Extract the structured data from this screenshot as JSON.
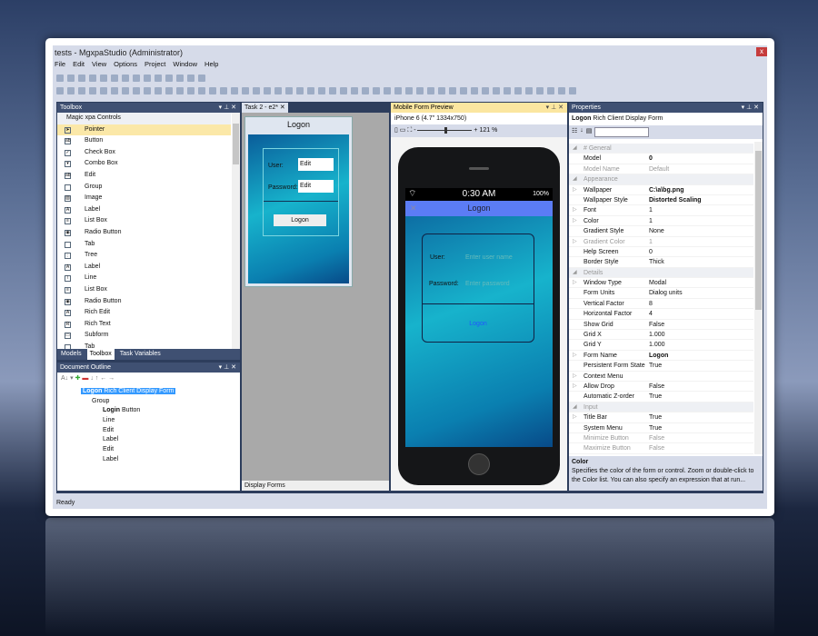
{
  "window": {
    "title": "tests - MgxpaStudio (Administrator)",
    "close": "x",
    "status": "Ready"
  },
  "menu": [
    "File",
    "Edit",
    "View",
    "Options",
    "Project",
    "Window",
    "Help"
  ],
  "toolbox": {
    "title": "Toolbox",
    "group": "Magic xpa Controls",
    "items": [
      {
        "label": "Pointer",
        "icon": "pointer-icon",
        "g": "➤"
      },
      {
        "label": "Button",
        "icon": "button-icon",
        "g": "ab"
      },
      {
        "label": "Check Box",
        "icon": "checkbox-icon",
        "g": "✓"
      },
      {
        "label": "Combo Box",
        "icon": "combo-box-icon",
        "g": "▾"
      },
      {
        "label": "Edit",
        "icon": "edit-icon",
        "g": "ab"
      },
      {
        "label": "Group",
        "icon": "group-icon",
        "g": ""
      },
      {
        "label": "Image",
        "icon": "image-icon",
        "g": "▨"
      },
      {
        "label": "Label",
        "icon": "label-icon",
        "g": "A"
      },
      {
        "label": "List Box",
        "icon": "list-box-icon",
        "g": "≡"
      },
      {
        "label": "Radio Button",
        "icon": "radio-button-icon",
        "g": "◉"
      },
      {
        "label": "Tab",
        "icon": "tab-icon",
        "g": ""
      },
      {
        "label": "Tree",
        "icon": "tree-icon",
        "g": "⋮"
      },
      {
        "label": "Label",
        "icon": "label-icon",
        "g": "A"
      },
      {
        "label": "Line",
        "icon": "line-icon",
        "g": "\\"
      },
      {
        "label": "List Box",
        "icon": "list-box-icon",
        "g": "≡"
      },
      {
        "label": "Radio Button",
        "icon": "radio-button-icon",
        "g": "◉"
      },
      {
        "label": "Rich Edit",
        "icon": "rich-edit-icon",
        "g": "A"
      },
      {
        "label": "Rich Text",
        "icon": "rich-text-icon",
        "g": "R"
      },
      {
        "label": "Subform",
        "icon": "subform-icon",
        "g": "▭"
      },
      {
        "label": "Tab",
        "icon": "tab-icon",
        "g": ""
      }
    ],
    "tabs": [
      "Models",
      "Toolbox",
      "Task Variables"
    ]
  },
  "outline": {
    "title": "Document Outline",
    "root_name": "Logon",
    "root_type": "Rich Client Display Form",
    "items": [
      {
        "name": "Group",
        "type": "",
        "depth": 1
      },
      {
        "name": "Login",
        "type": "Button",
        "depth": 2
      },
      {
        "name": "Line",
        "type": "",
        "depth": 2
      },
      {
        "name": "Edit",
        "type": "",
        "depth": 2
      },
      {
        "name": "Label",
        "type": "",
        "depth": 2
      },
      {
        "name": "Edit",
        "type": "",
        "depth": 2
      },
      {
        "name": "Label",
        "type": "",
        "depth": 2
      }
    ]
  },
  "task": {
    "tab": "Task  2 - e2*",
    "form_title": "Logon",
    "user_label": "User:",
    "user_value": "Edit",
    "password_label": "Password:",
    "password_value": "Edit",
    "button": "Logon",
    "bottom_tab": "Display Forms"
  },
  "preview": {
    "title": "Mobile Form Preview",
    "device": "iPhone 6 (4.7\" 1334x750)",
    "zoom": "121 %",
    "zoom_fraction": 0.5,
    "time": "0:30 AM",
    "battery": "100%",
    "form_title": "Logon",
    "user_label": "User:",
    "user_placeholder": "Enter user name",
    "password_label": "Password:",
    "password_placeholder": "Enter password",
    "button": "Logon",
    "header_color": "#5b7cf5"
  },
  "properties": {
    "title": "Properties",
    "object_name": "Logon",
    "object_type": "Rich Client Display Form",
    "rows": [
      {
        "k": "# General",
        "cat": true
      },
      {
        "k": "Model",
        "v": "0",
        "b": true
      },
      {
        "k": "Model Name",
        "v": "Default",
        "dis": true
      },
      {
        "k": "Appearance",
        "cat": true
      },
      {
        "k": "Wallpaper",
        "v": "C:\\a\\bg.png",
        "b": true,
        "exp": true
      },
      {
        "k": "Wallpaper Style",
        "v": "Distorted Scaling",
        "b": true
      },
      {
        "k": "Font",
        "v": "1",
        "exp": true
      },
      {
        "k": "Color",
        "v": "1",
        "exp": true
      },
      {
        "k": "Gradient Style",
        "v": "None"
      },
      {
        "k": "Gradient Color",
        "v": "1",
        "dis": true,
        "exp": true
      },
      {
        "k": "Help Screen",
        "v": "0"
      },
      {
        "k": "Border Style",
        "v": "Thick"
      },
      {
        "k": "Details",
        "cat": true
      },
      {
        "k": "Window Type",
        "v": "Modal",
        "exp": true
      },
      {
        "k": "Form Units",
        "v": "Dialog units"
      },
      {
        "k": "Vertical Factor",
        "v": "8"
      },
      {
        "k": "Horizontal Factor",
        "v": "4"
      },
      {
        "k": "Show Grid",
        "v": "False"
      },
      {
        "k": "Grid X",
        "v": "1.000"
      },
      {
        "k": "Grid Y",
        "v": "1.000"
      },
      {
        "k": "Form Name",
        "v": "Logon",
        "b": true,
        "exp": true
      },
      {
        "k": "Persistent Form State",
        "v": "True"
      },
      {
        "k": "Context Menu",
        "v": "",
        "exp": true
      },
      {
        "k": "Allow Drop",
        "v": "False",
        "exp": true
      },
      {
        "k": "Automatic Z-order",
        "v": "True"
      },
      {
        "k": "Input",
        "cat": true
      },
      {
        "k": "Title Bar",
        "v": "True",
        "exp": true
      },
      {
        "k": "System Menu",
        "v": "True"
      },
      {
        "k": "Minimize Button",
        "v": "False",
        "dis": true
      },
      {
        "k": "Maximize Button",
        "v": "False",
        "dis": true
      }
    ],
    "help_title": "Color",
    "help_text": "Specifies the color of the form or control. Zoom or double-click to the Color list. You can also specify an expression that at run..."
  }
}
